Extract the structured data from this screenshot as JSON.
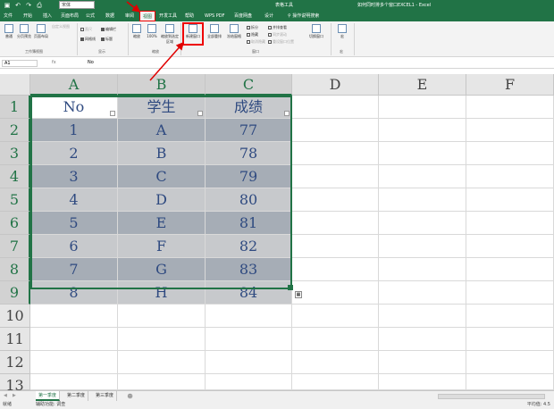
{
  "titlebar": {
    "font_box": "宋体",
    "context_tools": "表格工具",
    "title": "如何同时排多个窗口EXCEL1 - Excel"
  },
  "tabs": [
    {
      "label": "文件"
    },
    {
      "label": "开始"
    },
    {
      "label": "插入"
    },
    {
      "label": "页面布局"
    },
    {
      "label": "公式"
    },
    {
      "label": "数据"
    },
    {
      "label": "审阅"
    },
    {
      "label": "视图"
    },
    {
      "label": "开发工具"
    },
    {
      "label": "帮助"
    },
    {
      "label": "WPS PDF"
    },
    {
      "label": "百度网盘"
    },
    {
      "label": "设计"
    }
  ],
  "tell_me": "操作说明搜索",
  "ribbon": {
    "workbook_views": {
      "normal": "普通",
      "page_break": "分页预览",
      "page_layout": "页面布局",
      "custom_views": "自定义视图",
      "label": "工作簿视图"
    },
    "show": {
      "ruler": "直尺",
      "formula_bar": "编辑栏",
      "gridlines": "网格线",
      "headings": "标题",
      "label": "显示"
    },
    "zoom": {
      "zoom": "缩放",
      "hundred": "100%",
      "to_selection": "缩放到选定区域",
      "label": "缩放"
    },
    "window": {
      "new_window": "新建窗口",
      "arrange_all": "全部重排",
      "freeze_panes": "冻结窗格",
      "split": "拆分",
      "hide": "隐藏",
      "unhide": "取消隐藏",
      "side_by_side": "并排查看",
      "sync_scroll": "同步滚动",
      "reset_position": "重设窗口位置",
      "switch": "切换窗口",
      "label": "窗口"
    },
    "macros": {
      "macros": "宏",
      "label": "宏"
    }
  },
  "formula_bar": {
    "name_box": "A1",
    "fx": "fx",
    "value": "No"
  },
  "columns": [
    "A",
    "B",
    "C",
    "D",
    "E",
    "F"
  ],
  "rows": [
    "1",
    "2",
    "3",
    "4",
    "5",
    "6",
    "7",
    "8",
    "9",
    "10",
    "11",
    "12",
    "13",
    "14"
  ],
  "table": {
    "headers": [
      "No",
      "学生",
      "成绩"
    ],
    "data": [
      [
        "1",
        "A",
        "77"
      ],
      [
        "2",
        "B",
        "78"
      ],
      [
        "3",
        "C",
        "79"
      ],
      [
        "4",
        "D",
        "80"
      ],
      [
        "5",
        "E",
        "81"
      ],
      [
        "6",
        "F",
        "82"
      ],
      [
        "7",
        "G",
        "83"
      ],
      [
        "8",
        "H",
        "84"
      ]
    ]
  },
  "sheets": [
    {
      "label": "第一季度",
      "active": true
    },
    {
      "label": "第二季度",
      "active": false
    },
    {
      "label": "第三季度",
      "active": false
    }
  ],
  "status": {
    "ready": "就绪",
    "accessibility": "辅助功能: 调查",
    "zoom_level": "平均值: 4.5"
  },
  "colors": {
    "excel_green": "#217346",
    "annotation_red": "#e00000",
    "band_gray": "#a6adb6",
    "selection_gray": "#c7c9cc"
  }
}
